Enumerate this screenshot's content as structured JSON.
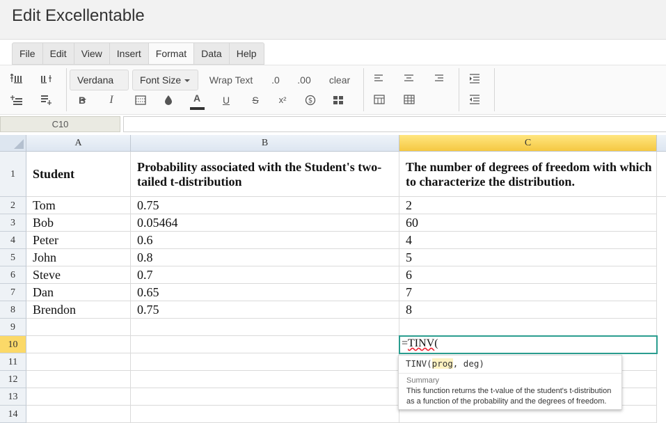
{
  "app": {
    "title": "Edit Excellentable"
  },
  "menu": [
    {
      "label": "File",
      "active": false
    },
    {
      "label": "Edit",
      "active": false
    },
    {
      "label": "View",
      "active": false
    },
    {
      "label": "Insert",
      "active": false
    },
    {
      "label": "Format",
      "active": true
    },
    {
      "label": "Data",
      "active": false
    },
    {
      "label": "Help",
      "active": false
    }
  ],
  "toolbar": {
    "font_family": "Verdana",
    "font_size": "Font Size",
    "wrap_text": "Wrap Text",
    "decimal_decrease": ".0",
    "decimal_increase": ".00",
    "clear": "clear",
    "bold": "B",
    "italic": "I",
    "font_color_letter": "A",
    "underline": "U",
    "strikethrough": "S",
    "superscript": "x²",
    "currency": "$",
    "colors": {
      "font_color_bar": "#333333"
    }
  },
  "formula_bar": {
    "cell_ref": "C10",
    "value": ""
  },
  "grid": {
    "columns": [
      "A",
      "B",
      "C"
    ],
    "selected_column": "C",
    "rows": [
      "1",
      "2",
      "3",
      "4",
      "5",
      "6",
      "7",
      "8",
      "9",
      "10",
      "11",
      "12",
      "13",
      "14"
    ],
    "selected_row": "10",
    "cells": [
      [
        "Student",
        "Probability associated with the Student's two-tailed t-distribution",
        "The number of degrees of freedom with which to characterize the distribution."
      ],
      [
        "Tom",
        "0.75",
        "2"
      ],
      [
        "Bob",
        "0.05464",
        "60"
      ],
      [
        "Peter",
        "0.6",
        "4"
      ],
      [
        "John",
        "0.8",
        "5"
      ],
      [
        "Steve",
        "0.7",
        "6"
      ],
      [
        "Dan",
        "0.65",
        "7"
      ],
      [
        "Brendon",
        "0.75",
        "8"
      ],
      [
        "",
        "",
        ""
      ],
      [
        "",
        "",
        ""
      ],
      [
        "",
        "",
        ""
      ],
      [
        "",
        "",
        ""
      ],
      [
        "",
        "",
        ""
      ],
      [
        "",
        "",
        ""
      ]
    ],
    "active_cell_editor": {
      "prefix": "=",
      "func": "TINV",
      "suffix": "("
    }
  },
  "autocomplete": {
    "fn_name": "TINV(",
    "arg1": "prog",
    "rest": ", deg)",
    "summary_heading": "Summary",
    "summary_text": "This function returns the t-value of the student's t-distribution as a function of the probability and the degrees of freedom.",
    "colors": {
      "active_border": "#2a9d8f",
      "col_highlight": "#f5c842"
    }
  }
}
